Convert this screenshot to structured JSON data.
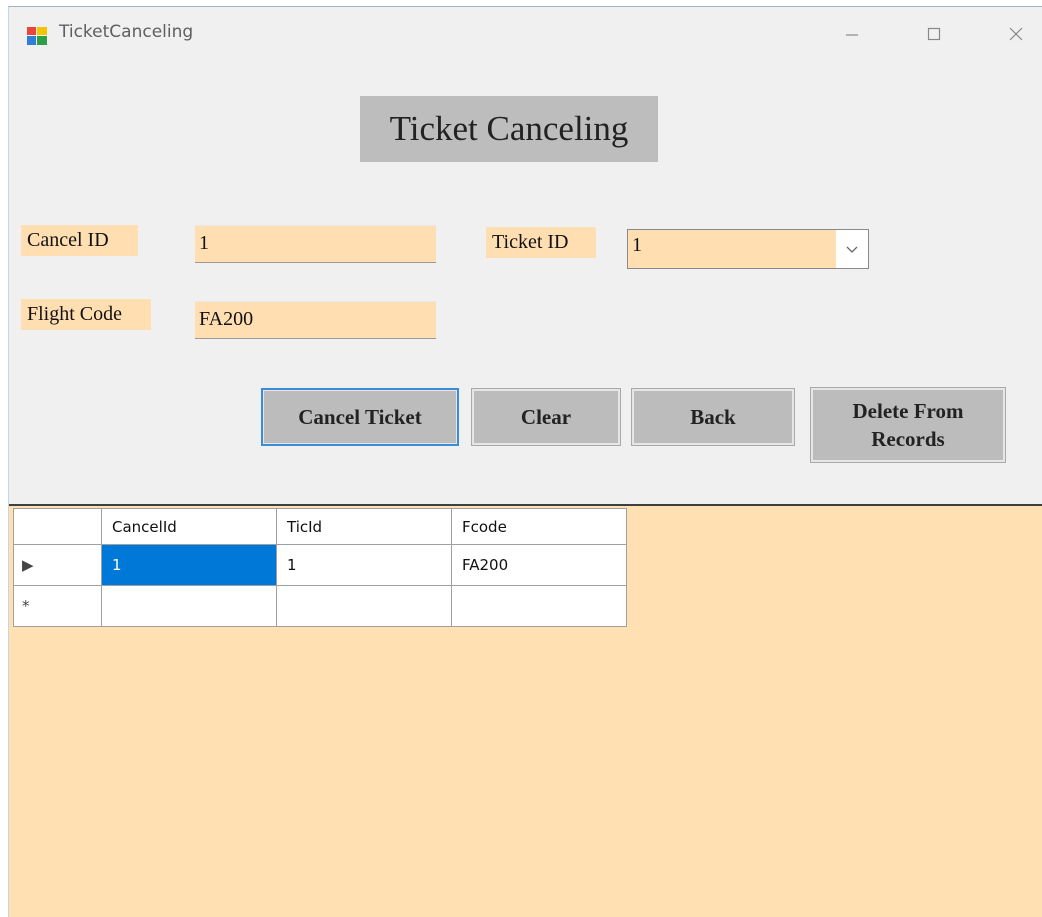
{
  "window": {
    "title": "TicketCanceling",
    "minimize_glyph": "—",
    "maximize_glyph": "☐",
    "close_glyph": "✕"
  },
  "form": {
    "heading": "Ticket Canceling",
    "cancel_id_label": "Cancel ID",
    "cancel_id_value": "1",
    "ticket_id_label": "Ticket ID",
    "ticket_id_value": "1",
    "flight_code_label": "Flight Code",
    "flight_code_value": "FA200"
  },
  "buttons": {
    "cancel_ticket": "Cancel Ticket",
    "clear": "Clear",
    "back": "Back",
    "delete_from_records": "Delete From Records"
  },
  "grid": {
    "columns": [
      "CancelId",
      "TicId",
      "Fcode"
    ],
    "rows": [
      {
        "indicator": "▶",
        "cells": [
          "1",
          "1",
          "FA200"
        ]
      },
      {
        "indicator": "*",
        "cells": [
          "",
          "",
          ""
        ]
      }
    ]
  },
  "colors": {
    "input_background": "#ffdfb2",
    "grid_background": "#ffe0b3",
    "button_gray": "#bcbcbc",
    "selection_blue": "#0078d7"
  }
}
